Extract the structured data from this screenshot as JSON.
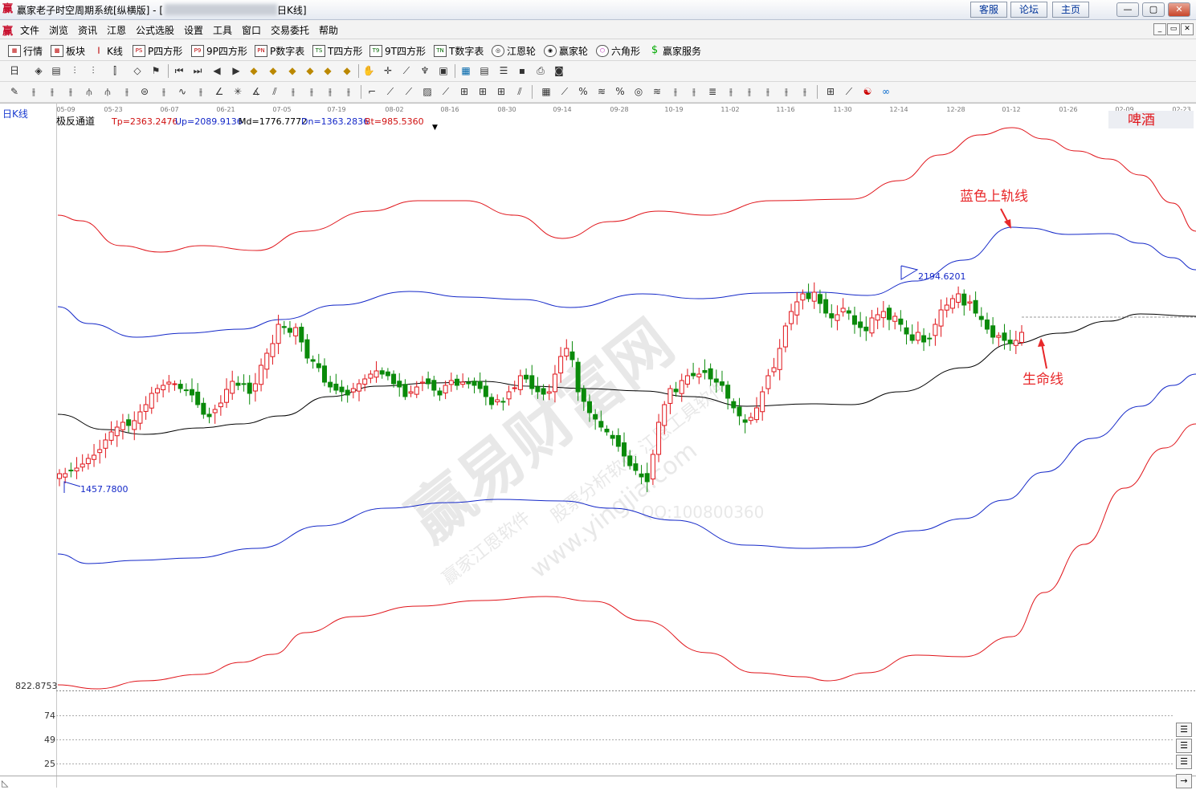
{
  "window": {
    "title": "赢家老子时空周期系统[纵横版] - [",
    "title_tail": "日K线]",
    "buttons": [
      "客服",
      "论坛",
      "主页"
    ],
    "controls": [
      "—",
      "▢",
      "✕"
    ]
  },
  "menu": [
    "文件",
    "浏览",
    "资讯",
    "江恩",
    "公式选股",
    "设置",
    "工具",
    "窗口",
    "交易委托",
    "帮助"
  ],
  "toolbar1": [
    "行情",
    "板块",
    "K线",
    "P四方形",
    "9P四方形",
    "P数字表",
    "T四方形",
    "9T四方形",
    "T数字表",
    "江恩轮",
    "赢家轮",
    "六角形",
    "赢家服务"
  ],
  "toolbar1_icons": [
    "table-icon",
    "grid-icon",
    "kline-icon",
    "PS",
    "P9",
    "PN",
    "TS",
    "T9",
    "TN",
    "wheel-icon",
    "wheel2-icon",
    "hexagon-icon",
    "dollar-icon"
  ],
  "chart": {
    "period_label": "日K线",
    "stock_name": "啤酒",
    "indicator": {
      "name": "极反通道",
      "tp": "Tp=2363.2476",
      "up": "Up=2089.9136",
      "md": "Md=1776.7772",
      "dn": "Dn=1363.2836",
      "bt": "Bt=985.5360"
    },
    "dates": [
      "05-09",
      "05-23",
      "06-07",
      "06-21",
      "07-05",
      "07-19",
      "08-02",
      "08-16",
      "08-30",
      "09-14",
      "09-28",
      "10-19",
      "11-02",
      "11-16",
      "11-30",
      "12-14",
      "12-28",
      "01-12",
      "01-26",
      "02-09",
      "02-23"
    ],
    "high_label": "2194.6201",
    "low_label": "1457.7800",
    "price_scale_label": "822.8753",
    "lower_panel_ticks": [
      "74",
      "49",
      "25"
    ],
    "annotations": {
      "upper_band": "蓝色上轨线",
      "life_line": "生命线"
    },
    "watermark": {
      "big": "赢易财富网",
      "small1": "赢家江恩软件",
      "small2": "股票分析软件 江恩工具软件",
      "url": "www.yingjia.com",
      "qq": "QQ:100800360"
    },
    "colors": {
      "band_outer": "#e0141a",
      "band_inner": "#1428c8",
      "mid_line": "#000000",
      "candle_up": "#e0141a",
      "candle_down": "#0a8a0a",
      "annotation": "#e8282a"
    }
  },
  "side_buttons": [
    "☰",
    "☰",
    "☰",
    "→"
  ]
}
